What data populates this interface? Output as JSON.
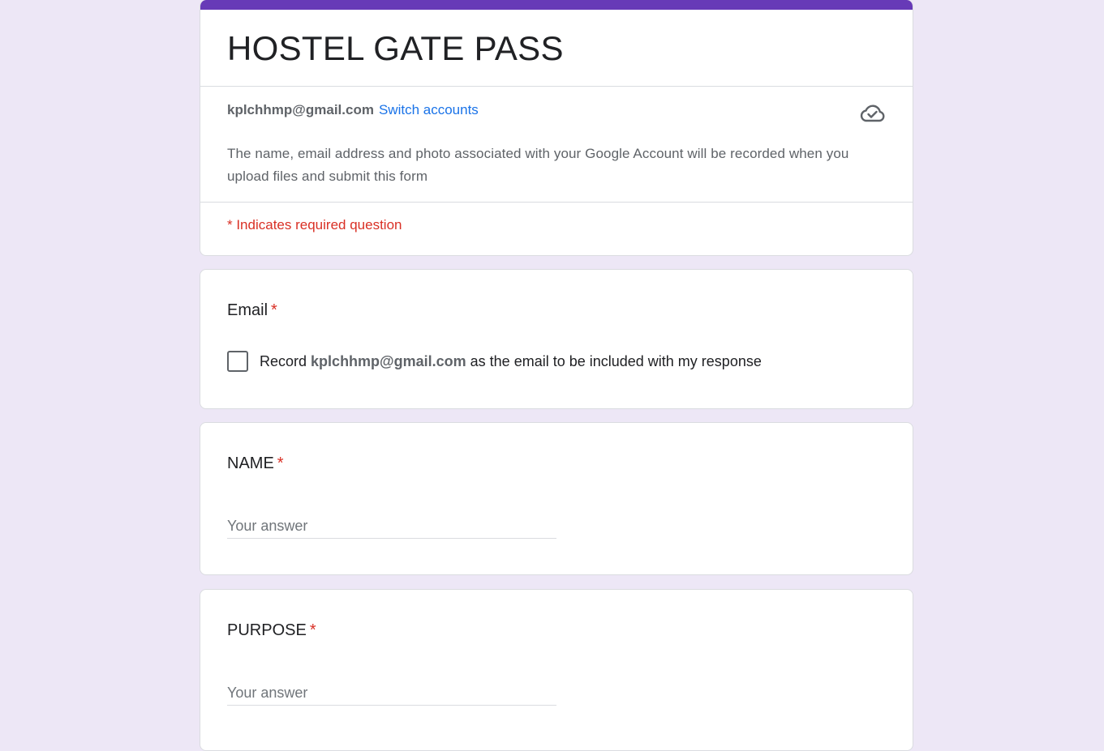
{
  "form": {
    "title": "HOSTEL GATE PASS",
    "account_email": "kplchhmp@gmail.com",
    "switch_accounts": "Switch accounts",
    "notice": "The name, email address and photo associated with your Google Account will be recorded when you upload files and submit this form",
    "required_note": "* Indicates required question",
    "accent_color": "#673ab7",
    "status_icon": "cloud-check-icon"
  },
  "questions": {
    "email": {
      "title": "Email",
      "required_mark": "*",
      "checkbox_prefix": "Record",
      "checkbox_email": "kplchhmp@gmail.com",
      "checkbox_suffix": "as the email to be included with my response",
      "checked": false
    },
    "name": {
      "title": "NAME",
      "required_mark": "*",
      "placeholder": "Your answer",
      "value": ""
    },
    "purpose": {
      "title": "PURPOSE",
      "required_mark": "*",
      "placeholder": "Your answer",
      "value": ""
    }
  }
}
